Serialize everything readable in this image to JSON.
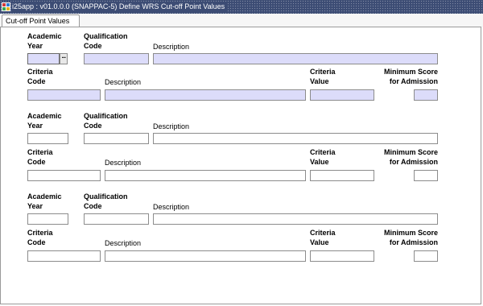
{
  "window": {
    "title": "i25app : v01.0.0.0 (SNAPPAC-5) Define WRS Cut-off Point Values"
  },
  "tabs": [
    {
      "label": "Cut-off Point Values"
    }
  ],
  "labels": {
    "academic": "Academic",
    "year": "Year",
    "qualification": "Qualification",
    "code": "Code",
    "description": "Description",
    "criteria": "Criteria",
    "value": "Value",
    "minimum_score": "Minimum Score",
    "for_admission": "for Admission"
  },
  "lov_button": "···",
  "records": [
    {
      "academic_year": "",
      "qualification_code": "",
      "qualification_description": "",
      "criteria_code": "",
      "criteria_description": "",
      "criteria_value": "",
      "minimum_score": ""
    },
    {
      "academic_year": "",
      "qualification_code": "",
      "qualification_description": "",
      "criteria_code": "",
      "criteria_description": "",
      "criteria_value": "",
      "minimum_score": ""
    },
    {
      "academic_year": "",
      "qualification_code": "",
      "qualification_description": "",
      "criteria_code": "",
      "criteria_description": "",
      "criteria_value": "",
      "minimum_score": ""
    }
  ],
  "colors": {
    "title_bar": "#3c4c74",
    "highlight_field": "#dcdcfa"
  }
}
